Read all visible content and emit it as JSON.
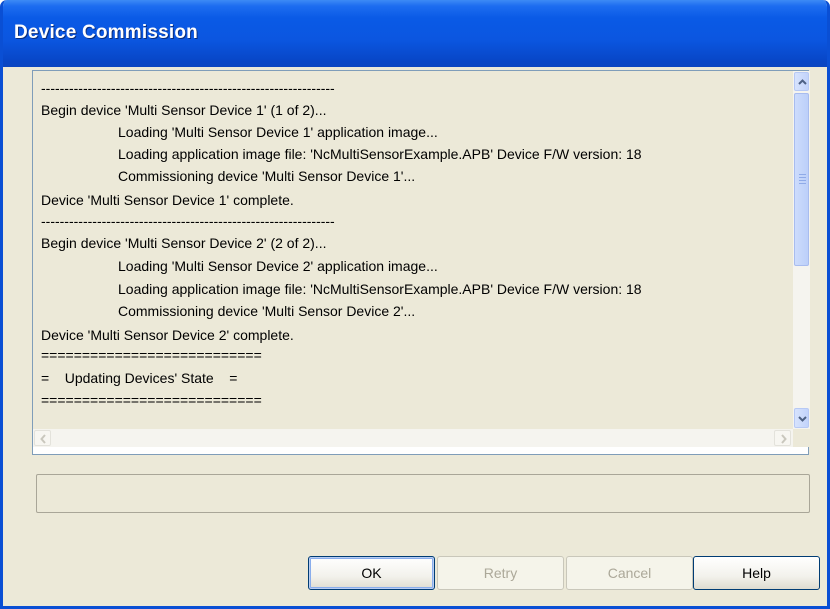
{
  "window": {
    "title": "Device Commission"
  },
  "log": {
    "lines": [
      "---------------------------------------------------------------",
      "Begin device 'Multi Sensor Device 1' (1 of 2)...",
      "Loading 'Multi Sensor Device 1' application image...",
      "Loading application image file: 'NcMultiSensorExample.APB' Device F/W version: 18",
      "Commissioning device 'Multi Sensor Device 1'...",
      "Device 'Multi Sensor Device 1' complete.",
      "---------------------------------------------------------------",
      "Begin device 'Multi Sensor Device 2' (2 of 2)...",
      "Loading 'Multi Sensor Device 2' application image...",
      "Loading application image file: 'NcMultiSensorExample.APB' Device F/W version: 18",
      "Commissioning device 'Multi Sensor Device 2'...",
      "Device 'Multi Sensor Device 2' complete.",
      "===========================",
      "=    Updating Devices' State    =",
      "==========================="
    ],
    "vertical_scroll_icons": [
      "chevron-up-icon",
      "chevron-down-icon"
    ],
    "horizontal_scroll_icons": [
      "chevron-left-icon",
      "chevron-right-icon"
    ]
  },
  "status": {
    "text": ""
  },
  "buttons": {
    "ok": "OK",
    "retry": "Retry",
    "cancel": "Cancel",
    "help": "Help"
  },
  "colors": {
    "titlebar": "#0a5ae6",
    "dialog_background": "#ece9d8",
    "disabled_text": "#aca899"
  }
}
